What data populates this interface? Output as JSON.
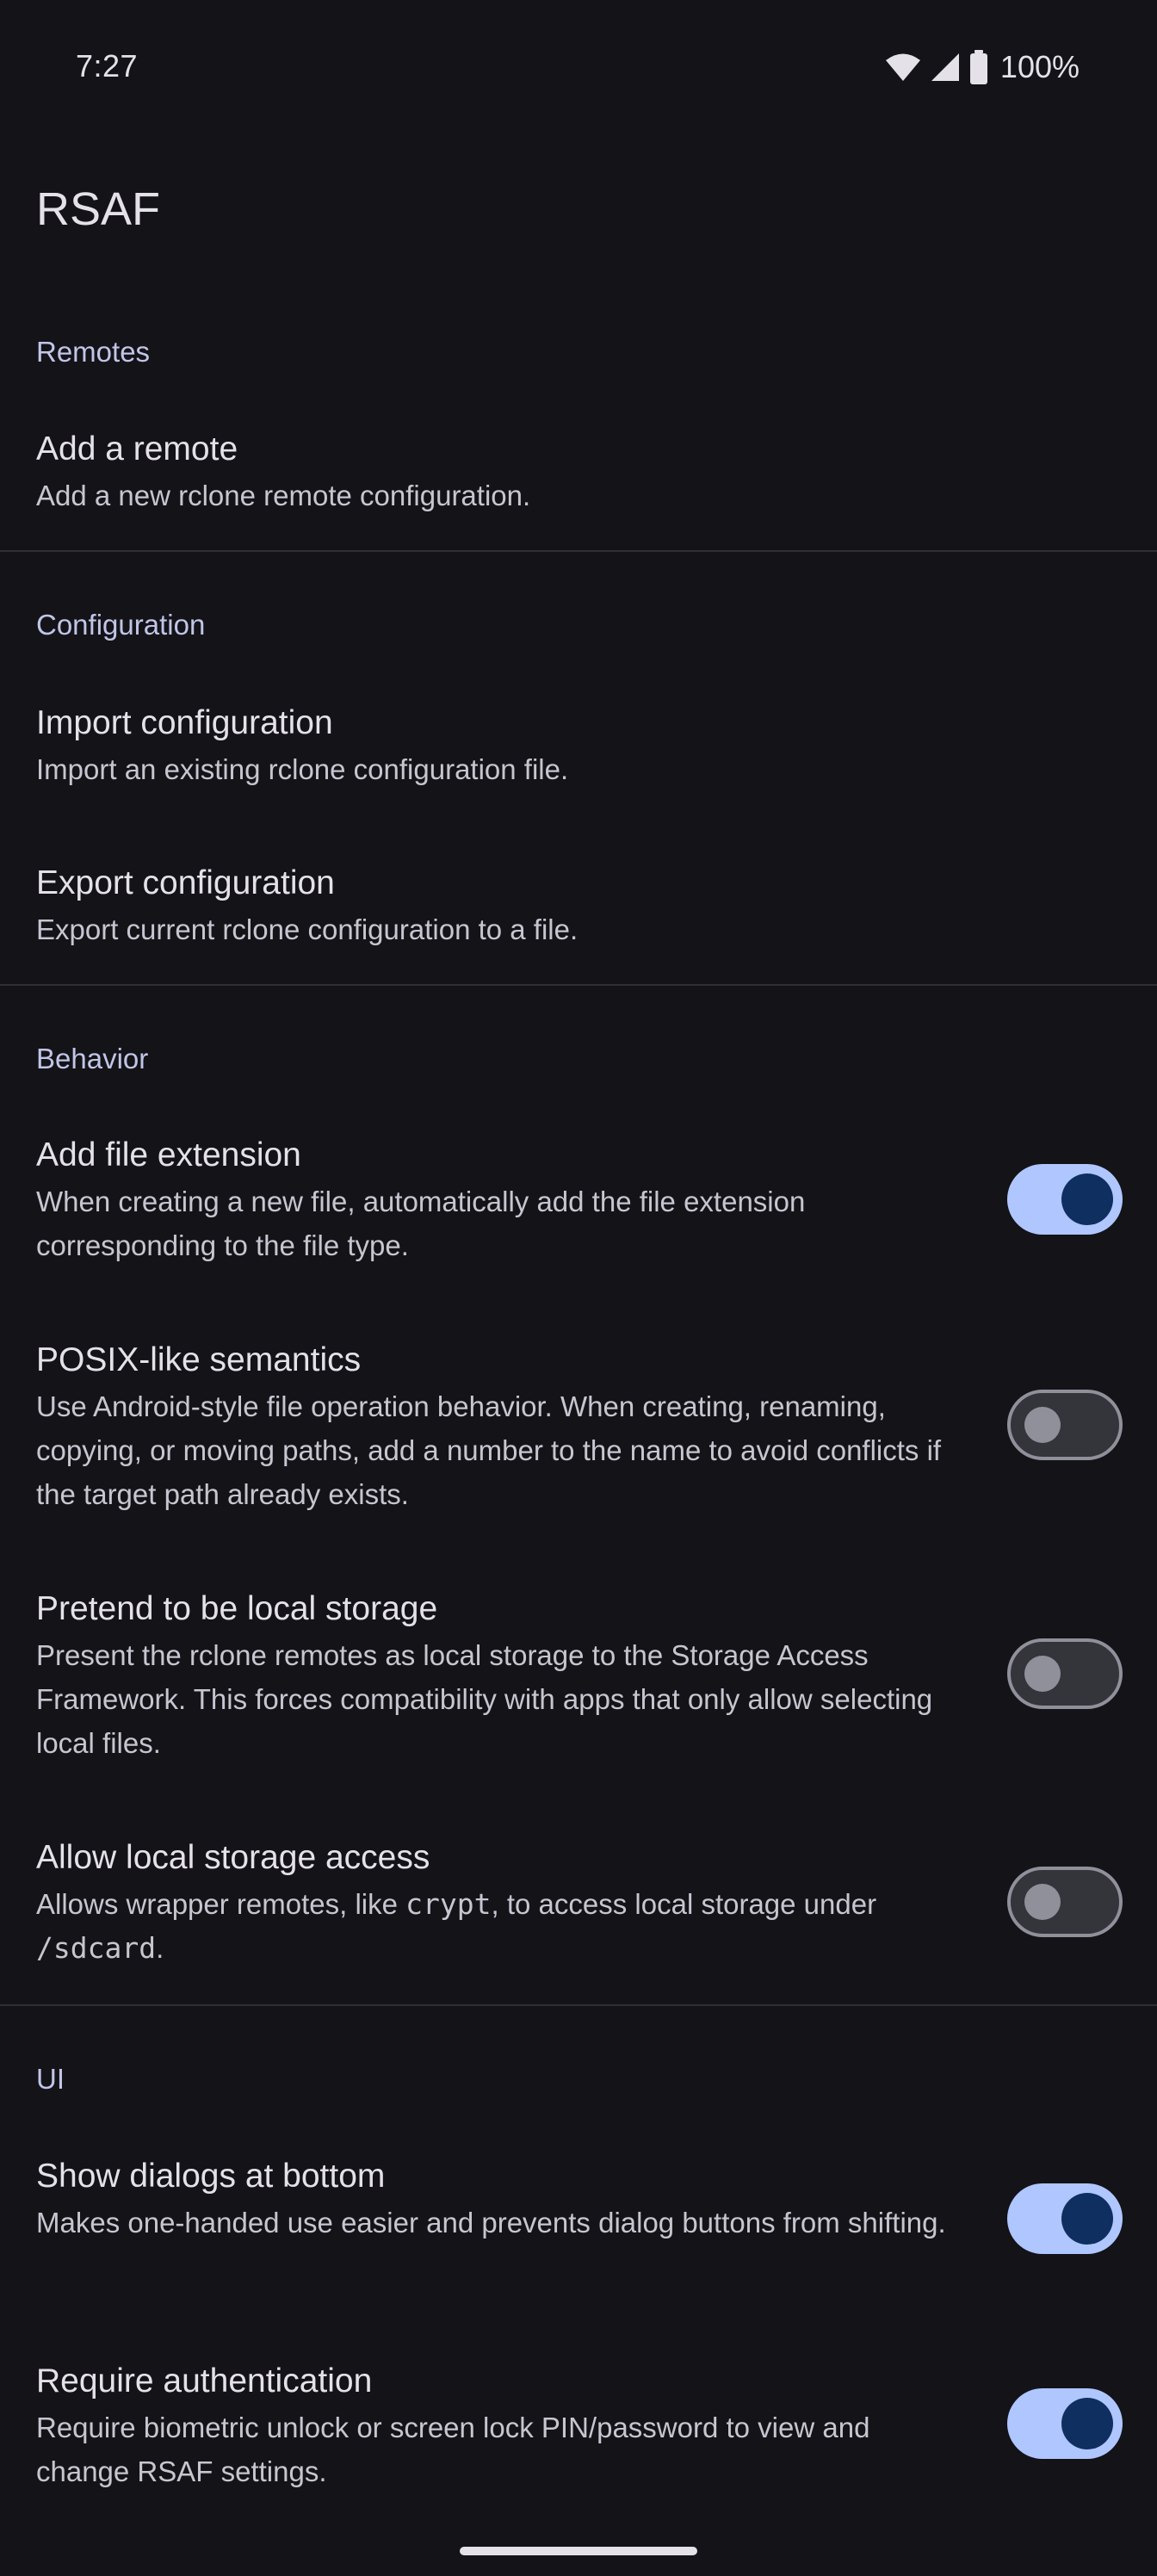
{
  "status_bar": {
    "time": "7:27",
    "battery": "100%"
  },
  "app": {
    "title": "RSAF"
  },
  "sections": {
    "remotes": {
      "header": "Remotes",
      "add_remote": {
        "title": "Add a remote",
        "summary": "Add a new rclone remote configuration."
      }
    },
    "configuration": {
      "header": "Configuration",
      "import": {
        "title": "Import configuration",
        "summary": "Import an existing rclone configuration file."
      },
      "export": {
        "title": "Export configuration",
        "summary": "Export current rclone configuration to a file."
      }
    },
    "behavior": {
      "header": "Behavior",
      "add_file_extension": {
        "title": "Add file extension",
        "summary": "When creating a new file, automatically add the file extension corresponding to the file type.",
        "enabled": true
      },
      "posix_semantics": {
        "title": "POSIX-like semantics",
        "summary": "Use Android-style file operation behavior. When creating, renaming, copying, or moving paths, add a number to the name to avoid conflicts if the target path already exists.",
        "enabled": false
      },
      "pretend_local": {
        "title": "Pretend to be local storage",
        "summary": "Present the rclone remotes as local storage to the Storage Access Framework. This forces compatibility with apps that only allow selecting local files.",
        "enabled": false
      },
      "local_storage_access": {
        "title": "Allow local storage access",
        "summary_pre": "Allows wrapper remotes, like ",
        "summary_code1": "crypt",
        "summary_mid": ", to access local storage under ",
        "summary_code2": "/sdcard",
        "summary_post": ".",
        "enabled": false
      }
    },
    "ui": {
      "header": "UI",
      "dialogs_bottom": {
        "title": "Show dialogs at bottom",
        "summary": "Makes one-handed use easier and prevents dialog buttons from shifting.",
        "enabled": true
      },
      "require_auth": {
        "title": "Require authentication",
        "summary": "Require biometric unlock or screen lock PIN/password to view and change RSAF settings.",
        "enabled": true
      }
    }
  },
  "colors": {
    "background": "#131318",
    "accent": "#afc6ff",
    "section_header": "#c1c5e6"
  }
}
